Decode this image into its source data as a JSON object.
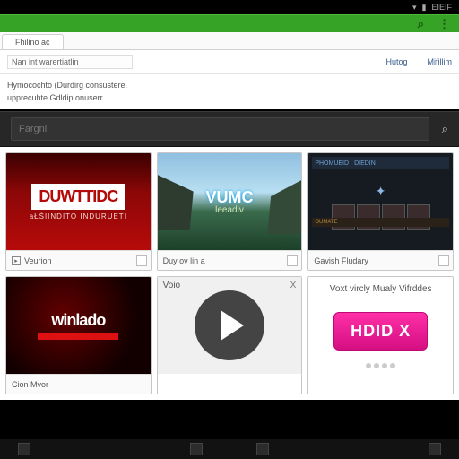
{
  "statusbar": {
    "signal": "▾",
    "battery": "▮",
    "label": "EIEIF"
  },
  "toolbar": {
    "search_icon": "⌕",
    "menu_icon": "⋮"
  },
  "tabstrip": {
    "tab1": "Fhilino ac"
  },
  "addressbar": {
    "url": "Nan int warertiatlin",
    "link1": "Hutog",
    "link2": "Mifillim"
  },
  "crumbs": {
    "line1": "Hymocochto (Durdirg consustere.",
    "line2": "upprecuhte Gdldip onuserr"
  },
  "search": {
    "placeholder": "Fargni",
    "icon": "⌕"
  },
  "cards": [
    {
      "thumb_class": "t-red",
      "logo": "DUWTTIDC",
      "sub": "aŁŚIINDITO INDURUETI",
      "icon": "▸",
      "caption": "Veurion"
    },
    {
      "thumb_class": "t-land",
      "logo": "VUMC",
      "sub": "leeadiv",
      "icon": "",
      "caption": "Duy ov lin a"
    },
    {
      "thumb_class": "t-dark",
      "top_a": "PHOMUEID",
      "top_b": "DIEDIN",
      "band": "OUMATE",
      "caption": "Gavish Fludary"
    },
    {
      "thumb_class": "t-black",
      "logo": "winlado",
      "sub_caption": "Cion Mvor"
    },
    {
      "thumb_class": "t-play",
      "top_label": "Voio",
      "close": "X"
    },
    {
      "thumb_class": "t-pink",
      "title": "Voxt vircly Mualy Vifrddes",
      "btn": "HDID X"
    }
  ],
  "bottombar": {}
}
